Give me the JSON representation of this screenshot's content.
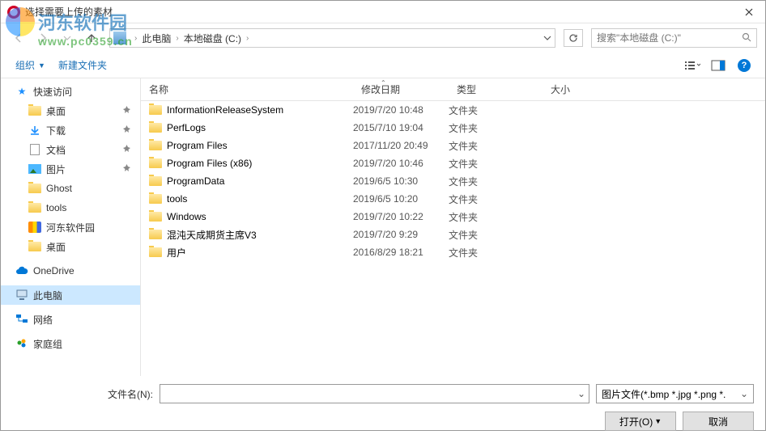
{
  "window": {
    "title": "选择需要上传的素材"
  },
  "watermark": {
    "site_name": "河东软件园",
    "url": "www.pc0359.cn"
  },
  "nav": {
    "breadcrumb": [
      "此电脑",
      "本地磁盘 (C:)"
    ],
    "search_placeholder": "搜索\"本地磁盘 (C:)\""
  },
  "toolbar": {
    "organize": "组织",
    "new_folder": "新建文件夹"
  },
  "sidebar": {
    "quick_access": "快速访问",
    "quick_items": [
      {
        "icon": "folder",
        "label": "桌面",
        "pinned": true
      },
      {
        "icon": "download",
        "label": "下载",
        "pinned": true
      },
      {
        "icon": "doc",
        "label": "文档",
        "pinned": true
      },
      {
        "icon": "picture",
        "label": "图片",
        "pinned": true
      },
      {
        "icon": "folder",
        "label": "Ghost",
        "pinned": false
      },
      {
        "icon": "folder",
        "label": "tools",
        "pinned": false
      },
      {
        "icon": "river",
        "label": "河东软件园",
        "pinned": false
      },
      {
        "icon": "folder",
        "label": "桌面",
        "pinned": false
      }
    ],
    "onedrive": "OneDrive",
    "this_pc": "此电脑",
    "network": "网络",
    "homegroup": "家庭组"
  },
  "columns": {
    "name": "名称",
    "date": "修改日期",
    "type": "类型",
    "size": "大小"
  },
  "files": [
    {
      "name": "InformationReleaseSystem",
      "date": "2019/7/20 10:48",
      "type": "文件夹"
    },
    {
      "name": "PerfLogs",
      "date": "2015/7/10 19:04",
      "type": "文件夹"
    },
    {
      "name": "Program Files",
      "date": "2017/11/20 20:49",
      "type": "文件夹"
    },
    {
      "name": "Program Files (x86)",
      "date": "2019/7/20 10:46",
      "type": "文件夹"
    },
    {
      "name": "ProgramData",
      "date": "2019/6/5 10:30",
      "type": "文件夹"
    },
    {
      "name": "tools",
      "date": "2019/6/5 10:20",
      "type": "文件夹"
    },
    {
      "name": "Windows",
      "date": "2019/7/20 10:22",
      "type": "文件夹"
    },
    {
      "name": "混沌天成期货主席V3",
      "date": "2019/7/20 9:29",
      "type": "文件夹"
    },
    {
      "name": "用户",
      "date": "2016/8/29 18:21",
      "type": "文件夹"
    }
  ],
  "footer": {
    "filename_label": "文件名(N):",
    "filter": "图片文件(*.bmp *.jpg *.png *.",
    "open": "打开(O)",
    "cancel": "取消"
  }
}
